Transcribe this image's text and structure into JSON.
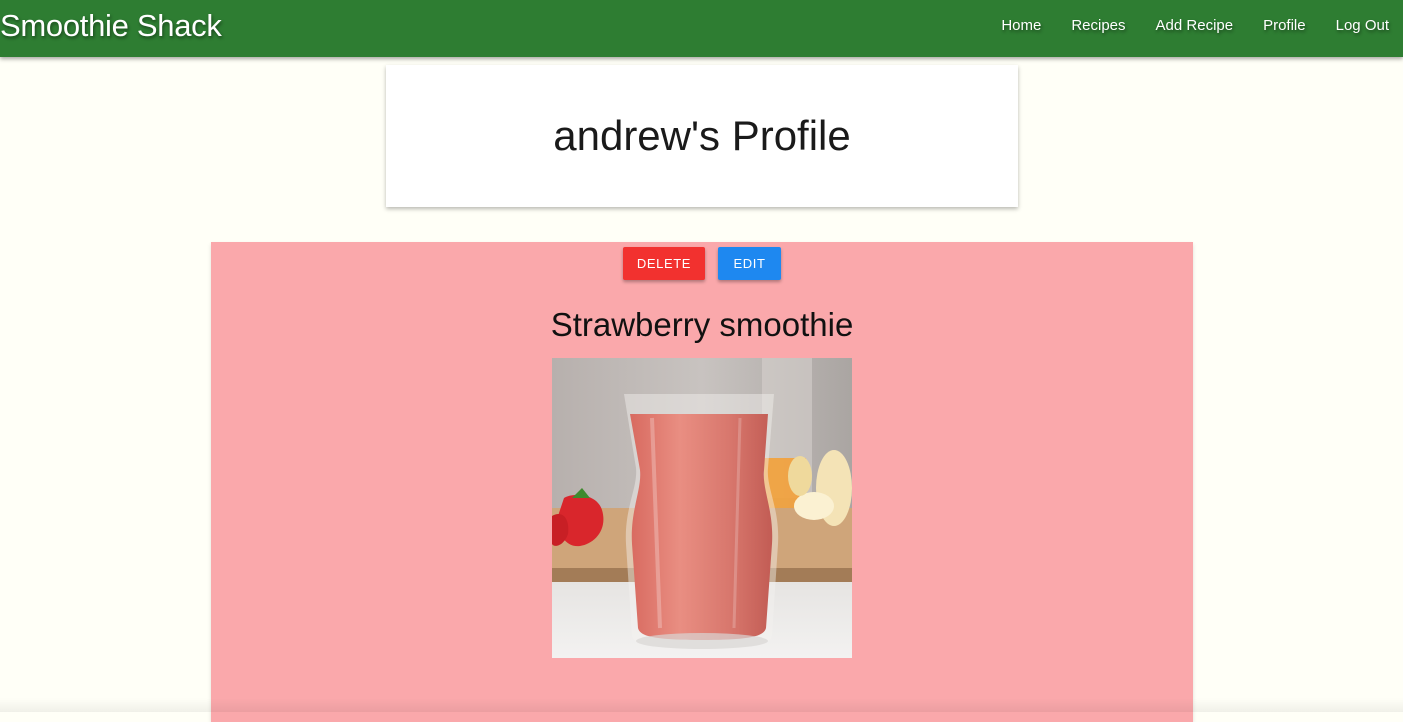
{
  "navbar": {
    "brand": "Smoothie Shack",
    "links": [
      "Home",
      "Recipes",
      "Add Recipe",
      "Profile",
      "Log Out"
    ]
  },
  "profile": {
    "title": "andrew's Profile"
  },
  "recipe": {
    "delete_label": "DELETE",
    "edit_label": "EDIT",
    "title": "Strawberry smoothie"
  },
  "colors": {
    "navbar": "#2e7d32",
    "page_background": "#fffff7",
    "recipe_card": "#faa8ab",
    "delete_button": "#f2312f",
    "edit_button": "#1e88f0"
  }
}
